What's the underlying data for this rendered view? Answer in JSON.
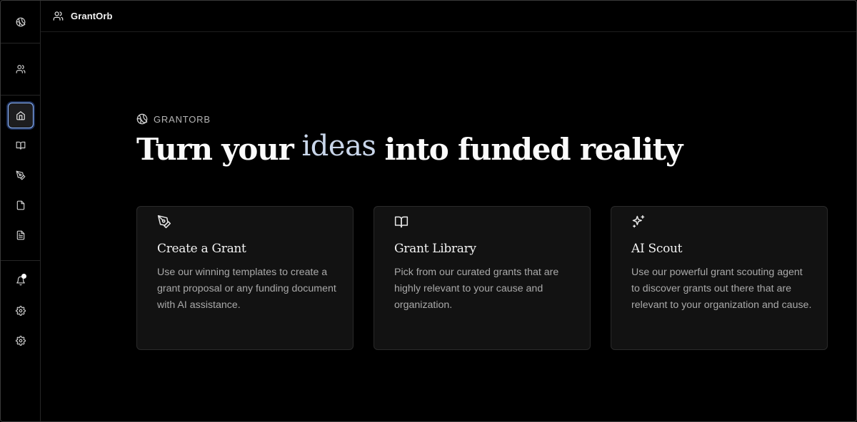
{
  "topbar": {
    "app_name": "GrantOrb",
    "icon": "users-icon"
  },
  "sidebar": {
    "logo_icon": "orb-logo-icon",
    "top_icon": "users-icon",
    "nav": [
      {
        "id": "home",
        "icon": "home-icon",
        "active": true
      },
      {
        "id": "library",
        "icon": "book-icon",
        "active": false
      },
      {
        "id": "create",
        "icon": "pen-tool-icon",
        "active": false
      },
      {
        "id": "document",
        "icon": "file-icon",
        "active": false
      },
      {
        "id": "text-document",
        "icon": "file-text-icon",
        "active": false
      }
    ],
    "bottom": [
      {
        "id": "notifications",
        "icon": "bell-icon",
        "has_badge": true
      },
      {
        "id": "settings-1",
        "icon": "gear-icon"
      },
      {
        "id": "settings-2",
        "icon": "gear-icon"
      }
    ]
  },
  "hero": {
    "brand": "GRANTORB",
    "headline_before": "Turn your",
    "headline_highlight": "ideas",
    "headline_after": "into funded reality"
  },
  "cards": [
    {
      "icon": "pen-tool-icon",
      "title": "Create a Grant",
      "description": "Use our winning templates to create a grant proposal or any funding document with AI assistance."
    },
    {
      "icon": "book-open-icon",
      "title": "Grant Library",
      "description": "Pick from our curated grants that are highly relevant to your cause and organization."
    },
    {
      "icon": "sparkles-icon",
      "title": "AI Scout",
      "description": "Use our powerful grant scouting agent to discover grants out there that are relevant to your organization and cause."
    }
  ],
  "colors": {
    "background": "#000000",
    "card": "#121212",
    "accent": "#8fb8ff",
    "highlight": "#c9d6ea"
  }
}
